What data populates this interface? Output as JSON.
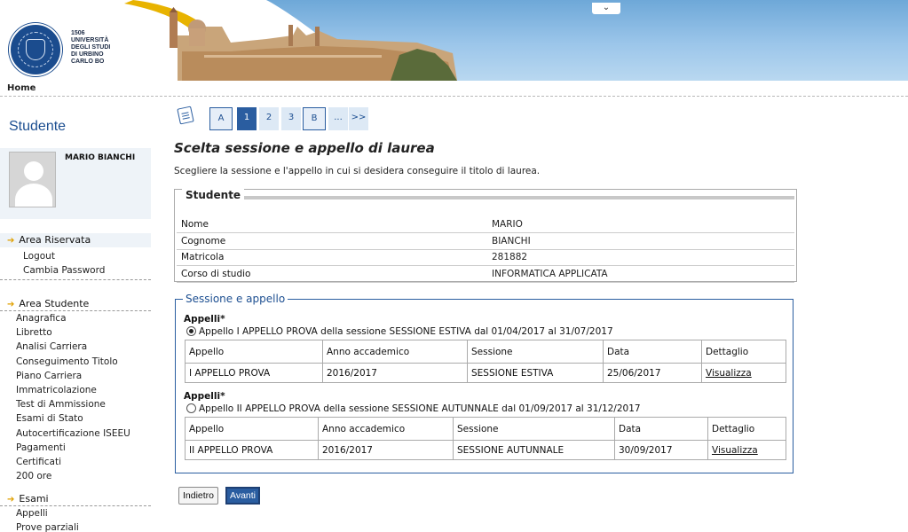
{
  "header": {
    "university_lines": [
      "1506",
      "UNIVERSITÀ",
      "DEGLI STUDI",
      "DI URBINO",
      "CARLO BO"
    ],
    "toggle_icon": "chevron-down-icon"
  },
  "breadcrumb": {
    "home": "Home"
  },
  "sidebar": {
    "title": "Studente",
    "profile_name": "MARIO BIANCHI",
    "area_riservata": {
      "label": "Area Riservata",
      "items": [
        "Logout",
        "Cambia Password"
      ]
    },
    "area_studente": {
      "label": "Area Studente",
      "items": [
        "Anagrafica",
        "Libretto",
        "Analisi Carriera",
        "Conseguimento Titolo",
        "Piano Carriera",
        "Immatricolazione",
        "Test di Ammissione",
        "Esami di Stato",
        "Autocertificazione ISEEU",
        "Pagamenti",
        "Certificati",
        "200 ore"
      ]
    },
    "esami": {
      "label": "Esami",
      "items": [
        "Appelli",
        "Prove parziali"
      ]
    }
  },
  "steps": [
    "A",
    "1",
    "2",
    "3",
    "B",
    "...",
    ">>"
  ],
  "active_step": "1",
  "main": {
    "title": "Scelta sessione e appello di laurea",
    "description": "Scegliere la sessione e l'appello in cui si desidera conseguire il titolo di laurea."
  },
  "student": {
    "legend": "Studente",
    "rows": [
      {
        "label": "Nome",
        "value": "MARIO"
      },
      {
        "label": "Cognome",
        "value": "BIANCHI"
      },
      {
        "label": "Matricola",
        "value": "281882"
      },
      {
        "label": "Corso di studio",
        "value": "INFORMATICA APPLICATA"
      }
    ]
  },
  "session": {
    "legend": "Sessione e appello",
    "columns": [
      "Appello",
      "Anno accademico",
      "Sessione",
      "Data",
      "Dettaglio"
    ],
    "appelli": [
      {
        "group_label": "Appelli*",
        "radio_label": "Appello I APPELLO PROVA della sessione SESSIONE ESTIVA dal 01/04/2017 al 31/07/2017",
        "selected": true,
        "row": [
          "I APPELLO PROVA",
          "2016/2017",
          "SESSIONE ESTIVA",
          "25/06/2017",
          "Visualizza"
        ]
      },
      {
        "group_label": "Appelli*",
        "radio_label": "Appello II APPELLO PROVA della sessione SESSIONE AUTUNNALE dal 01/09/2017 al 31/12/2017",
        "selected": false,
        "row": [
          "II APPELLO PROVA",
          "2016/2017",
          "SESSIONE AUTUNNALE",
          "30/09/2017",
          "Visualizza"
        ]
      }
    ]
  },
  "buttons": {
    "back": "Indietro",
    "next": "Avanti"
  },
  "colors": {
    "accent": "#2a5da0",
    "title_blue": "#1d4f91",
    "arrow": "#e0a000",
    "header_yellow": "#e8b300"
  }
}
